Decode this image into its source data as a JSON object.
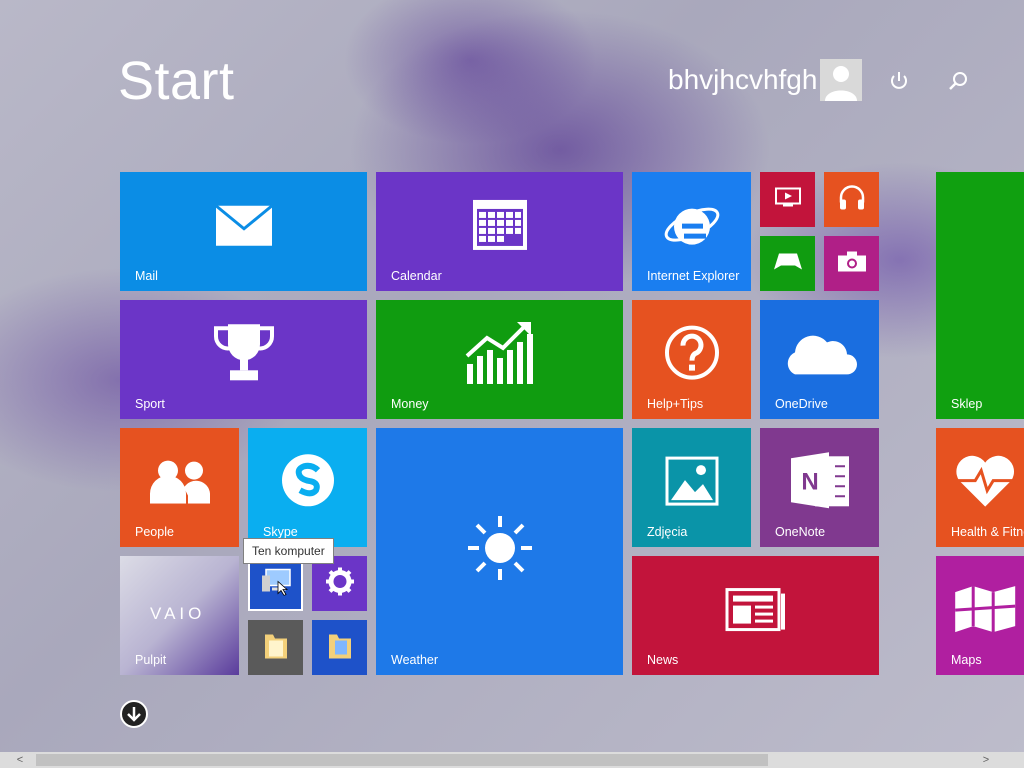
{
  "header": {
    "title": "Start",
    "user_name": "bhvjhcvhfgh",
    "avatar_icon": "user-avatar-icon",
    "power_icon": "power-icon",
    "search_icon": "search-icon"
  },
  "tiles": {
    "mail": {
      "label": "Mail",
      "color": "#0b8de5"
    },
    "calendar": {
      "label": "Calendar",
      "color": "#6b35c7"
    },
    "internet_explorer": {
      "label": "Internet Explorer",
      "color": "#1a7ef0"
    },
    "video": {
      "label": "",
      "color": "#c2143b"
    },
    "music": {
      "label": "",
      "color": "#e65220"
    },
    "games": {
      "label": "",
      "color": "#109c10"
    },
    "camera": {
      "label": "",
      "color": "#b01f87"
    },
    "sport": {
      "label": "Sport",
      "color": "#6b35c7"
    },
    "money": {
      "label": "Money",
      "color": "#109c10"
    },
    "help_tips": {
      "label": "Help+Tips",
      "color": "#e65220"
    },
    "onedrive": {
      "label": "OneDrive",
      "color": "#1a6ee0"
    },
    "store": {
      "label": "Sklep",
      "color": "#10a010"
    },
    "people": {
      "label": "People",
      "color": "#e65220"
    },
    "skype": {
      "label": "Skype",
      "color": "#0aaef0"
    },
    "weather": {
      "label": "Weather",
      "color": "#1e79e8"
    },
    "photos": {
      "label": "Zdjęcia",
      "color": "#0a94a8"
    },
    "onenote": {
      "label": "OneNote",
      "color": "#80398f"
    },
    "health": {
      "label": "Health & Fitne",
      "color": "#e65220"
    },
    "desktop": {
      "label": "Pulpit"
    },
    "this_pc": {
      "label": "",
      "color": "#1e52c9"
    },
    "settings": {
      "label": "",
      "color": "#6b35c7"
    },
    "file_explorer": {
      "label": "",
      "color": "#5a5a5a"
    },
    "libraries": {
      "label": "",
      "color": "#1e52c9"
    },
    "news": {
      "label": "News",
      "color": "#c2143b"
    },
    "maps": {
      "label": "Maps",
      "color": "#b01fa0"
    },
    "vaio_logo": "VAIO"
  },
  "tooltip": {
    "text": "Ten komputer"
  },
  "bottom": {
    "apps_icon": "arrow-down-circle-icon"
  },
  "scrollbar": {
    "left_arrow": "<",
    "right_arrow": ">"
  }
}
